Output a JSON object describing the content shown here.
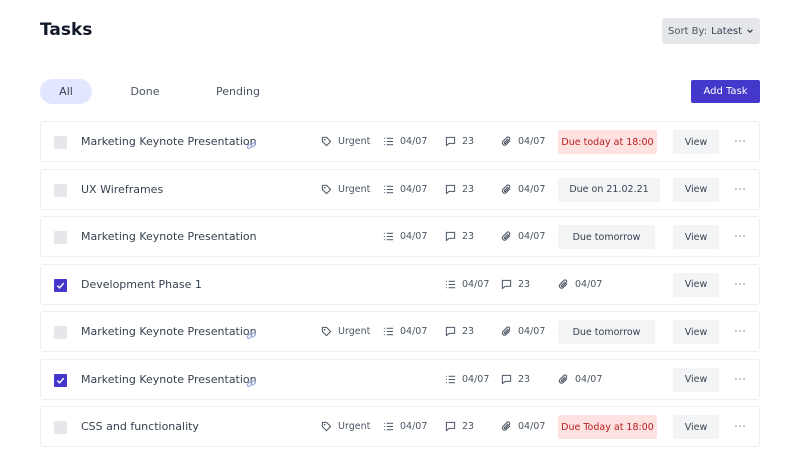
{
  "header": {
    "title": "Tasks",
    "sort_label": "Sort By:",
    "sort_value": "Latest",
    "add_label": "Add Task"
  },
  "filters": [
    {
      "label": "All",
      "active": true
    },
    {
      "label": "Done",
      "active": false
    },
    {
      "label": "Pending",
      "active": false
    }
  ],
  "colors": {
    "accent": "#4338ca",
    "danger_bg": "#fee2e2",
    "danger_text": "#b91c1c"
  },
  "tasks": [
    {
      "name": "Marketing Keynote Presentation",
      "checked": false,
      "has_link": true,
      "tag": "Urgent",
      "subtasks": "04/07",
      "comments": "23",
      "attachments": "04/07",
      "due": "Due today at 18:00",
      "due_red": true,
      "view": "View"
    },
    {
      "name": "UX Wireframes",
      "checked": false,
      "has_link": false,
      "tag": "Urgent",
      "subtasks": "04/07",
      "comments": "23",
      "attachments": "04/07",
      "due": "Due on 21.02.21",
      "due_red": false,
      "view": "View"
    },
    {
      "name": "Marketing Keynote Presentation",
      "checked": false,
      "has_link": false,
      "tag": "",
      "subtasks": "04/07",
      "comments": "23",
      "attachments": "04/07",
      "due": "Due tomorrow",
      "due_red": false,
      "view": "View"
    },
    {
      "name": "Development Phase 1",
      "checked": true,
      "has_link": false,
      "tag": "",
      "subtasks": "04/07",
      "comments": "23",
      "attachments": "04/07",
      "due": "",
      "due_red": false,
      "view": "View"
    },
    {
      "name": "Marketing Keynote Presentation",
      "checked": false,
      "has_link": true,
      "tag": "Urgent",
      "subtasks": "04/07",
      "comments": "23",
      "attachments": "04/07",
      "due": "Due tomorrow",
      "due_red": false,
      "view": "View"
    },
    {
      "name": "Marketing Keynote Presentation",
      "checked": true,
      "has_link": true,
      "tag": "",
      "subtasks": "04/07",
      "comments": "23",
      "attachments": "04/07",
      "due": "",
      "due_red": false,
      "view": "View"
    },
    {
      "name": "CSS and functionality",
      "checked": false,
      "has_link": false,
      "tag": "Urgent",
      "subtasks": "04/07",
      "comments": "23",
      "attachments": "04/07",
      "due": "Due Today at 18:00",
      "due_red": true,
      "view": "View"
    }
  ]
}
